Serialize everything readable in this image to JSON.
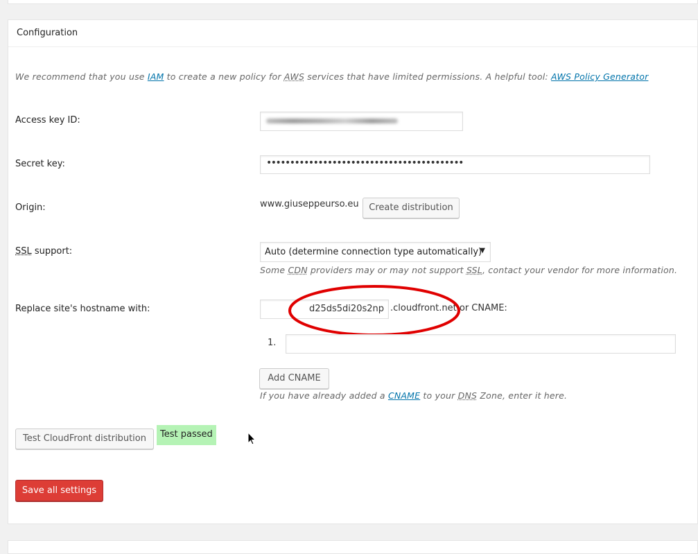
{
  "header": {
    "title": "Configuration"
  },
  "notice": {
    "prefix": "We recommend that you use ",
    "iam_link": "IAM",
    "middle": " to create a new policy for ",
    "aws_abbr": "AWS",
    "suffix": " services that have limited permissions. A helpful tool: ",
    "policy_link": "AWS Policy Generator"
  },
  "access_key": {
    "label": "Access key ID:",
    "value": ""
  },
  "secret_key": {
    "label": "Secret key:",
    "value": "••••••••••••••••••••••••••••••••••••••••••"
  },
  "origin": {
    "label": "Origin:",
    "value": "www.giuseppeurso.eu",
    "button": "Create distribution"
  },
  "ssl": {
    "label_abbr": "SSL",
    "label_suffix": " support:",
    "selected": "Auto (determine connection type automatically)",
    "arrow": "▼",
    "hint_prefix": "Some ",
    "hint_cdn": "CDN",
    "hint_middle": " providers may or may not support ",
    "hint_ssl": "SSL",
    "hint_suffix": ", contact your vendor for more information."
  },
  "hostname": {
    "label": "Replace site's hostname with:",
    "subdomain_value": "d25ds5di20s2np",
    "domain_suffix": ".cloudfront.net",
    "or_cname": " or CNAME:",
    "cname_index": "1.",
    "cname_value": "",
    "add_button": "Add CNAME",
    "hint_prefix": "If you have already added a ",
    "hint_cname": "CNAME",
    "hint_middle": " to your ",
    "hint_dns": "DNS",
    "hint_suffix": " Zone, enter it here."
  },
  "test": {
    "button": "Test CloudFront distribution",
    "result": "Test passed",
    "result_color": "#b5f3b5"
  },
  "save": {
    "button": "Save all settings",
    "color": "#dd3d36"
  }
}
